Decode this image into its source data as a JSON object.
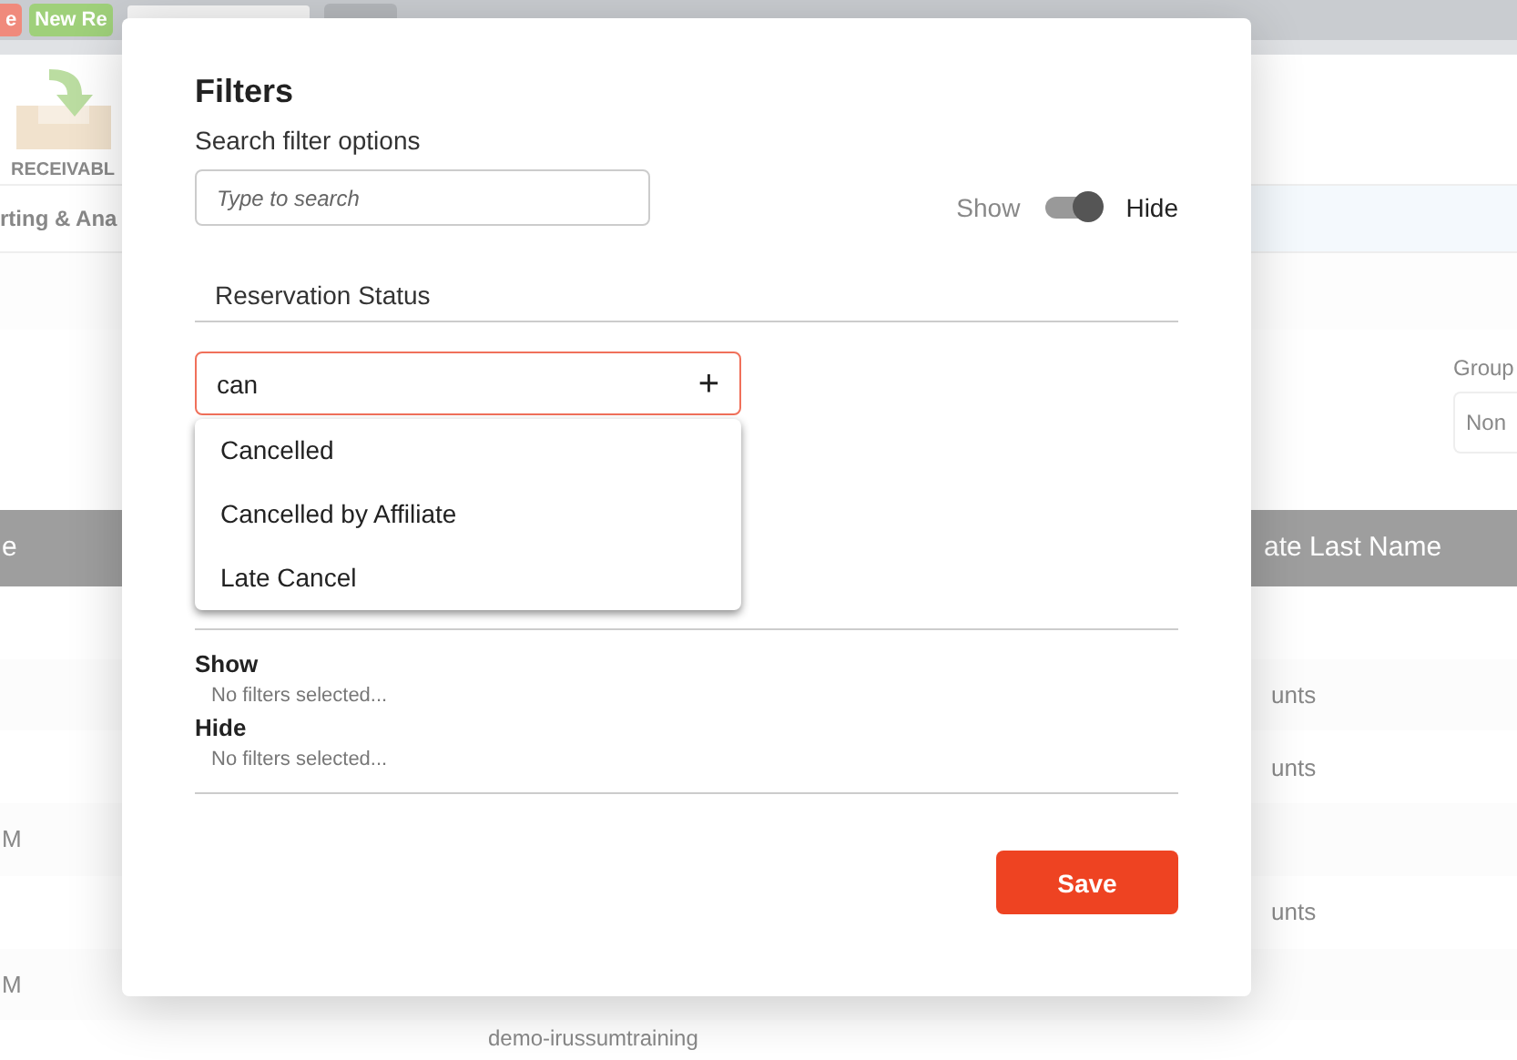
{
  "background": {
    "top_buttons": [
      {
        "label": "e",
        "color": "#f08a7c"
      },
      {
        "label": "New Re",
        "color": "#9fd07a"
      }
    ],
    "toolbar_item": {
      "label": "RECEIVABL"
    },
    "nav_label": "rting & Ana",
    "group": {
      "label": "Group",
      "value": "Non"
    },
    "table": {
      "header_left": "e",
      "header_right": "ate Last Name",
      "rows": [
        {
          "left": "",
          "right": ""
        },
        {
          "left": "",
          "right": "unts"
        },
        {
          "left": "",
          "right": "unts"
        },
        {
          "left": "M",
          "right": ""
        },
        {
          "left": "",
          "right": "unts"
        },
        {
          "left": "M",
          "right": ""
        }
      ],
      "bottom_text": "demo-irussumtraining"
    }
  },
  "modal": {
    "title": "Filters",
    "search_label": "Search filter options",
    "search": {
      "placeholder": "Type to search"
    },
    "toggle": {
      "left_label": "Show",
      "right_label": "Hide",
      "on": true
    },
    "section": "Reservation Status",
    "combo": {
      "value": "can",
      "icon": "+"
    },
    "options": [
      {
        "label": "Cancelled"
      },
      {
        "label": "Cancelled by Affiliate"
      },
      {
        "label": "Late Cancel"
      }
    ],
    "groups": [
      {
        "title": "Show",
        "empty": "No filters selected..."
      },
      {
        "title": "Hide",
        "empty": "No filters selected..."
      }
    ],
    "save": "Save"
  }
}
